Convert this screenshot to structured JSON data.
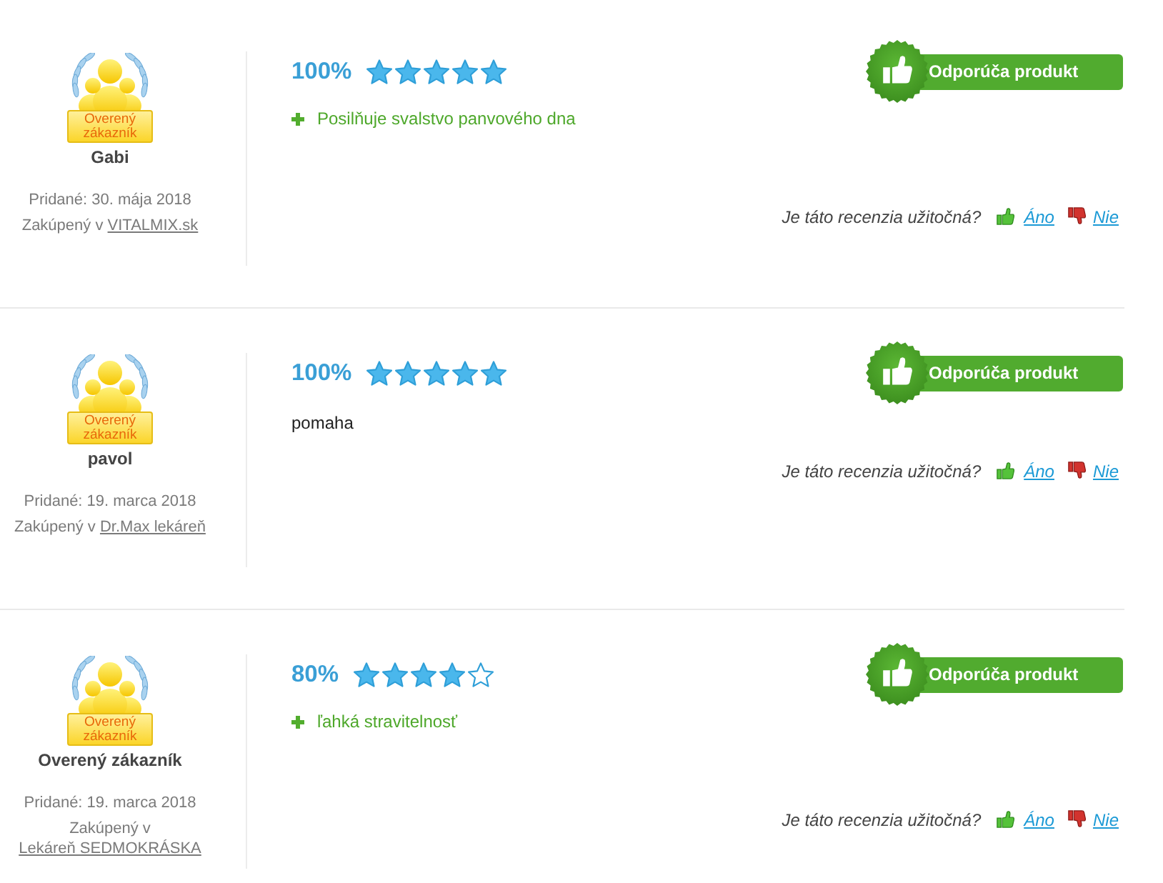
{
  "reviews": [
    {
      "reviewer": {
        "badge": "Overený zákazník",
        "name": "Gabi",
        "added": "Pridané: 30. mája 2018",
        "purchased_prefix": "Zakúpený v",
        "shop": "VITALMIX.sk"
      },
      "score": "100%",
      "stars": 5,
      "recommend": "Odporúča produkt",
      "pros": [
        "Posilňuje svalstvo panvového dna"
      ],
      "helpful": {
        "question": "Je táto recenzia užitočná?",
        "yes": "Áno",
        "no": "Nie"
      }
    },
    {
      "reviewer": {
        "badge": "Overený zákazník",
        "name": "pavol",
        "added": "Pridané: 19. marca 2018",
        "purchased_prefix": "Zakúpený v",
        "shop": "Dr.Max lekáreň"
      },
      "score": "100%",
      "stars": 5,
      "recommend": "Odporúča produkt",
      "comment": "pomaha",
      "helpful": {
        "question": "Je táto recenzia užitočná?",
        "yes": "Áno",
        "no": "Nie"
      }
    },
    {
      "reviewer": {
        "badge": "Overený zákazník",
        "name": "Overený zákazník",
        "added": "Pridané: 19. marca 2018",
        "purchased_prefix": "Zakúpený v",
        "shop": "Lekáreň SEDMOKRÁSKA"
      },
      "score": "80%",
      "stars": 4,
      "recommend": "Odporúča produkt",
      "pros": [
        "ľahká stravitelnosť"
      ],
      "helpful": {
        "question": "Je táto recenzia užitočná?",
        "yes": "Áno",
        "no": "Nie"
      }
    }
  ]
}
